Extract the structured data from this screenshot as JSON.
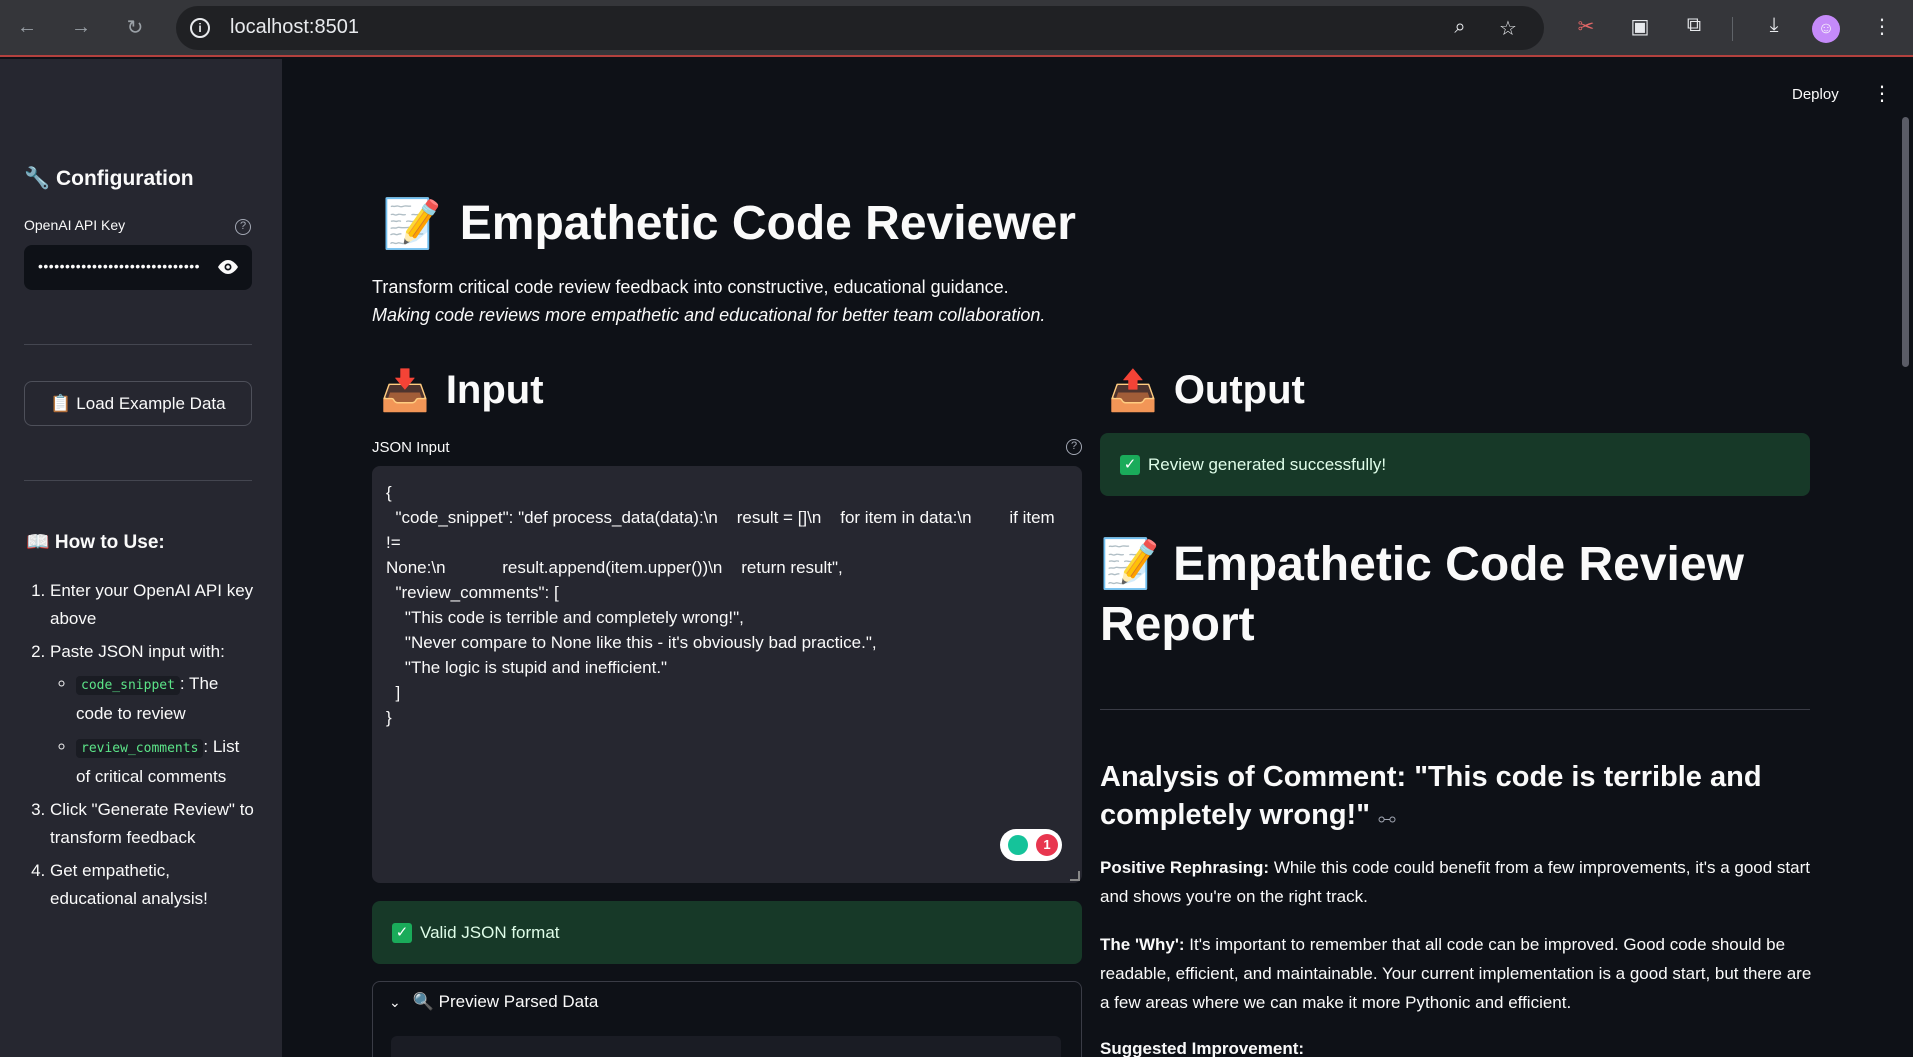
{
  "browser": {
    "url": "localhost:8501"
  },
  "sidebar": {
    "title": "🔧 Configuration",
    "api_key_label": "OpenAI API Key",
    "api_key_value": "••••••••••••••••••••••••••••••",
    "load_button_label": "📋 Load Example Data",
    "how_to_title": "📖 How to Use:",
    "steps": [
      "Enter your OpenAI API key above",
      "Paste JSON input with:",
      "Click \"Generate Review\" to transform feedback",
      "Get empathetic, educational analysis!"
    ],
    "sub_items": [
      {
        "code": "code_snippet",
        "text": ": The code to review"
      },
      {
        "code": "review_comments",
        "text": ": List of critical comments"
      }
    ]
  },
  "header": {
    "deploy_label": "Deploy"
  },
  "page": {
    "title_icon": "📝",
    "title": "Empathetic Code Reviewer",
    "subtitle": "Transform critical code review feedback into constructive, educational guidance.",
    "subtitle_italic": "Making code reviews more empathetic and educational for better team collaboration."
  },
  "input": {
    "heading_icon": "📥",
    "heading": "Input",
    "field_label": "JSON Input",
    "json_text": "{\n  \"code_snippet\": \"def process_data(data):\\n    result = []\\n    for item in data:\\n        if item !=\nNone:\\n            result.append(item.upper())\\n    return result\",\n  \"review_comments\": [\n    \"This code is terrible and completely wrong!\",\n    \"Never compare to None like this - it's obviously bad practice.\",\n    \"The logic is stupid and inefficient.\"\n  ]\n}",
    "grammarly_count": "1",
    "valid_message": "Valid JSON format",
    "preview_label": "🔍 Preview Parsed Data"
  },
  "output": {
    "heading_icon": "📤",
    "heading": "Output",
    "success_message": "Review generated successfully!",
    "report_title": "📝 Empathetic Code Review Report",
    "analysis_heading": "Analysis of Comment: \"This code is terrible and completely wrong!\"",
    "positive_label": "Positive Rephrasing:",
    "positive_text": " While this code could benefit from a few improvements, it's a good start and shows you're on the right track.",
    "why_label": "The 'Why':",
    "why_text": " It's important to remember that all code can be improved. Good code should be readable, efficient, and maintainable. Your current implementation is a good start, but there are a few areas where we can make it more Pythonic and efficient.",
    "suggested_label": "Suggested Improvement:"
  },
  "colors": {
    "app_background": "#0e1117",
    "sidebar_background": "#262730",
    "success_background": "#173928",
    "accent_red": "#ff4b4b"
  }
}
